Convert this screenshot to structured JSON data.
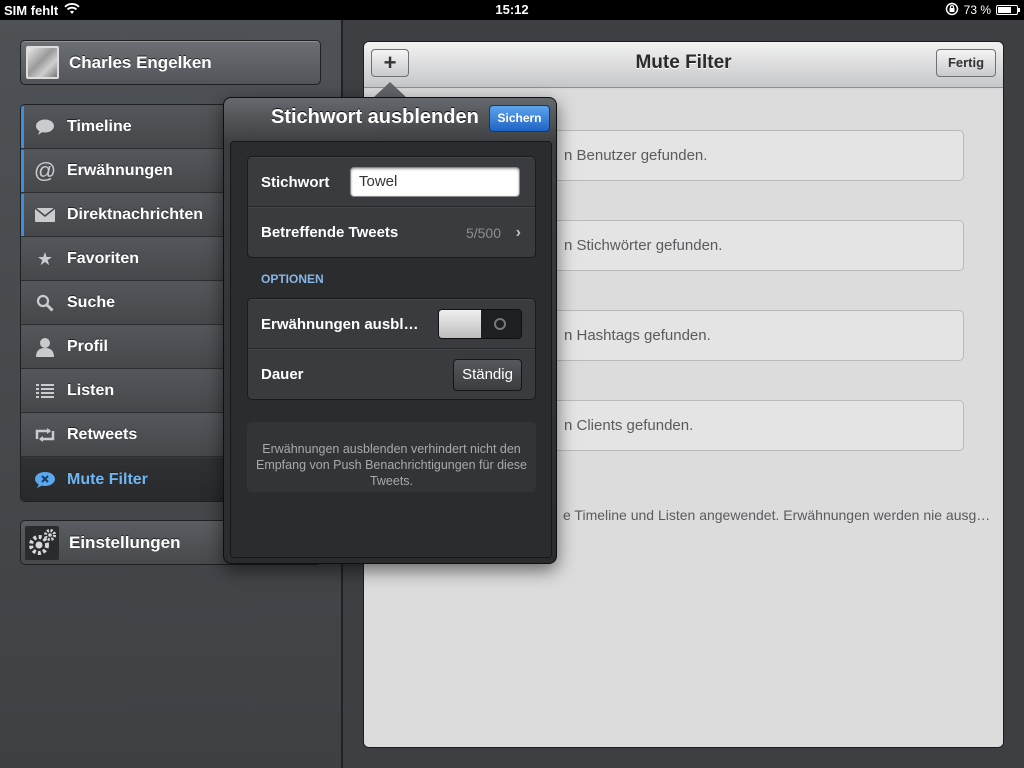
{
  "status_bar": {
    "carrier": "SIM fehlt",
    "time": "15:12",
    "battery": "73 %",
    "battery_level": 0.73
  },
  "sidebar": {
    "user_name": "Charles Engelken",
    "items": [
      {
        "label": "Timeline",
        "icon": "speech-bubble-icon",
        "unread": true
      },
      {
        "label": "Erwähnungen",
        "icon": "at-sign-icon",
        "unread": true
      },
      {
        "label": "Direktnachrichten",
        "icon": "envelope-icon",
        "unread": true
      },
      {
        "label": "Favoriten",
        "icon": "star-icon",
        "unread": false
      },
      {
        "label": "Suche",
        "icon": "search-icon",
        "unread": false
      },
      {
        "label": "Profil",
        "icon": "person-icon",
        "unread": false
      },
      {
        "label": "Listen",
        "icon": "list-icon",
        "unread": false
      },
      {
        "label": "Retweets",
        "icon": "retweet-icon",
        "unread": false
      },
      {
        "label": "Mute Filter",
        "icon": "mute-filter-icon",
        "unread": false,
        "active": true
      }
    ],
    "settings_label": "Einstellungen"
  },
  "panel": {
    "title": "Mute Filter",
    "add_label": "+",
    "done_label": "Fertig",
    "rows": [
      "n Benutzer gefunden.",
      "n Stichwörter gefunden.",
      "n Hashtags gefunden.",
      "n Clients gefunden."
    ],
    "footer_note": "e Timeline und Listen angewendet. Erwähnungen werden nie ausg…"
  },
  "popover": {
    "title": "Stichwort ausblenden",
    "save_label": "Sichern",
    "keyword_label": "Stichwort",
    "keyword_value": "Towel",
    "tweets_label": "Betreffende Tweets",
    "tweets_value": "5/500",
    "options_header": "OPTIONEN",
    "mentions_label": "Erwähnungen ausbl…",
    "mentions_toggle_on": false,
    "duration_label": "Dauer",
    "duration_value": "Ständig",
    "info_text": "Erwähnungen ausblenden verhindert nicht den Empfang von Push Benachrichtigungen für diese Tweets."
  },
  "colors": {
    "accent_blue": "#3e8ed8",
    "active_label": "#6fb6f5",
    "save_button": "#2a6fcf"
  }
}
